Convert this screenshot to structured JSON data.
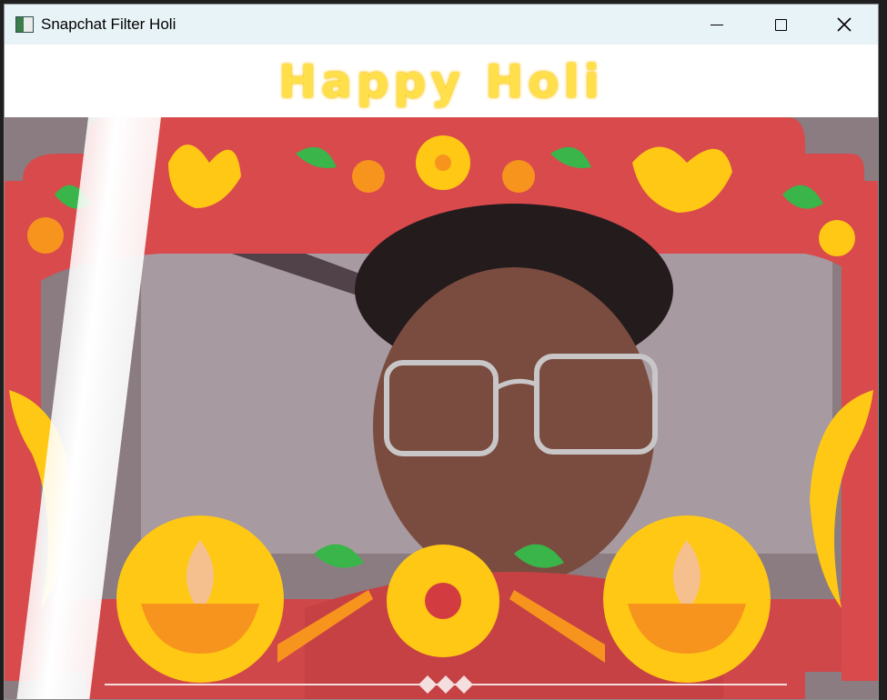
{
  "window": {
    "title": "Snapchat Filter Holi",
    "icon": "app-window-icon",
    "controls": [
      "minimize-icon",
      "maximize-icon",
      "close-icon"
    ]
  },
  "filter": {
    "headline": "Happy Holi",
    "colors": {
      "frame_red": "#d84a4c",
      "marigold": "#ffc814",
      "orange": "#f7941d",
      "leaf_green": "#39b54a",
      "titlebar": "#e8f3f8",
      "text_gold": "#ffe04a"
    }
  }
}
